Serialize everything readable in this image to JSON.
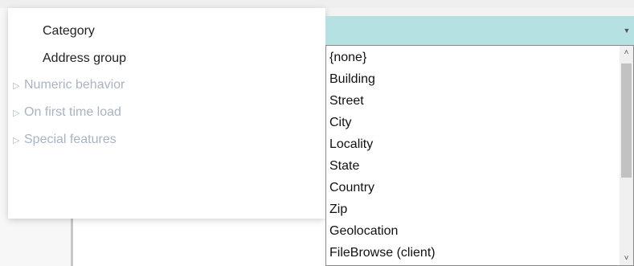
{
  "properties": {
    "rows": [
      {
        "label": "Category",
        "kind": "field"
      },
      {
        "label": "Address group",
        "kind": "field"
      },
      {
        "label": "Numeric behavior",
        "kind": "section"
      },
      {
        "label": "On first time load",
        "kind": "section"
      },
      {
        "label": "Special features",
        "kind": "section"
      }
    ],
    "section_icon": "triangle-right-icon"
  },
  "dropdown": {
    "selected_value": "",
    "arrow_icon": "chevron-down-icon",
    "options": [
      "{none}",
      "Building",
      "Street",
      "City",
      "Locality",
      "State",
      "Country",
      "Zip",
      "Geolocation",
      "FileBrowse (client)"
    ],
    "scroll_position": 0.08
  },
  "colors": {
    "selected_field_bg": "#b6e1e2",
    "section_text": "#a9b4c2"
  }
}
